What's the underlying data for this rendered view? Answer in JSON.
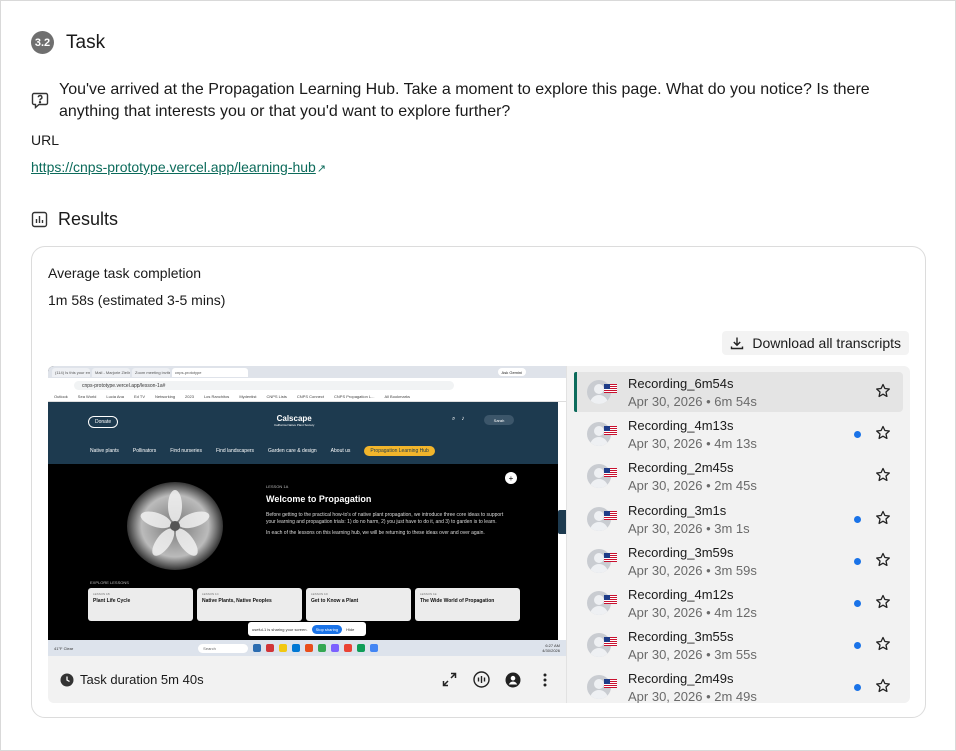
{
  "task": {
    "step": "3.2",
    "title": "Task"
  },
  "question": {
    "text": "You've arrived at the Propagation Learning Hub. Take a moment to explore this page. What do you notice? Is there anything that interests you or that you'd want to explore further?"
  },
  "url": {
    "label": "URL",
    "link": "https://cnps-prototype.vercel.app/learning-hub",
    "external_glyph": "↗"
  },
  "results": {
    "title": "Results",
    "avg_label": "Average task completion",
    "avg_value": "1m 58s (estimated 3-5 mins)",
    "download_label": "Download all transcripts"
  },
  "player": {
    "duration_label": "Task duration 5m 40s",
    "controls": [
      "expand-icon",
      "audio-waveform-icon",
      "person-icon",
      "more-vertical-icon"
    ],
    "screen": {
      "tabs": [
        "(114) Is this your email?",
        "Mail - Marjorie Zielinski - Outl",
        "Zoom meeting invite",
        "cnps-prototype"
      ],
      "gemini": "Ask Gemini",
      "address": "cnps-prototype.vercel.app/lesson-1a#",
      "bookmarks": [
        "Outlook",
        "Sea World",
        "Lucia Ana",
        "Ed TV",
        "Networking",
        "2023",
        "Los Ranchitos",
        "Mydentist",
        "CNPS Lists",
        "CNPS Connect",
        "CNPS Propagation L...",
        "All Bookmarks"
      ],
      "site": {
        "donate": "Donate",
        "logo": "Calscape",
        "logo_sub": "California Native Plant Society",
        "user": "Sarah",
        "nav": [
          "Native plants",
          "Pollinators",
          "Find nurseries",
          "Find landscapers",
          "Garden care & design",
          "About us"
        ],
        "hub_button": "Propagation Learning Hub",
        "lesson_kicker": "LESSON 1A",
        "lesson_title": "Welcome to Propagation",
        "lesson_body_1": "Before getting to the practical how-to's of native plant propagation, we introduce three core ideas to support your learning and propagation trials: 1) do no harm, 2) you just have to do it, and 3) to garden is to learn.",
        "lesson_body_2": "In each of the lessons on this learning hub, we will be returning to these ideas over and over again.",
        "explore_label": "EXPLORE LESSONS",
        "cards": [
          {
            "kicker": "LESSON 1B",
            "title": "Plant Life Cycle"
          },
          {
            "kicker": "LESSON 1C",
            "title": "Native Plants, Native Peoples"
          },
          {
            "kicker": "LESSON 1D",
            "title": "Get to Know a Plant"
          },
          {
            "kicker": "LESSON 1E",
            "title": "The Wide World of Propagation"
          }
        ],
        "share_text": "useful-1 is sharing your screen.",
        "stop_label": "Stop sharing",
        "hide_label": "Hide"
      },
      "taskbar": {
        "weather": "41°F Clear",
        "search": "Search",
        "time": "6:27 AM",
        "date": "4/30/2026"
      }
    }
  },
  "recordings": [
    {
      "name": "Recording_6m54s",
      "date": "Apr 30, 2026",
      "duration": "6m 54s",
      "new": false,
      "selected": true
    },
    {
      "name": "Recording_4m13s",
      "date": "Apr 30, 2026",
      "duration": "4m 13s",
      "new": true,
      "selected": false
    },
    {
      "name": "Recording_2m45s",
      "date": "Apr 30, 2026",
      "duration": "2m 45s",
      "new": false,
      "selected": false
    },
    {
      "name": "Recording_3m1s",
      "date": "Apr 30, 2026",
      "duration": "3m 1s",
      "new": true,
      "selected": false
    },
    {
      "name": "Recording_3m59s",
      "date": "Apr 30, 2026",
      "duration": "3m 59s",
      "new": true,
      "selected": false
    },
    {
      "name": "Recording_4m12s",
      "date": "Apr 30, 2026",
      "duration": "4m 12s",
      "new": true,
      "selected": false
    },
    {
      "name": "Recording_3m55s",
      "date": "Apr 30, 2026",
      "duration": "3m 55s",
      "new": true,
      "selected": false
    },
    {
      "name": "Recording_2m49s",
      "date": "Apr 30, 2026",
      "duration": "2m 49s",
      "new": true,
      "selected": false
    }
  ],
  "separator": " • ",
  "colors": {
    "accent": "#0c6b5b",
    "new_dot": "#1a73e8",
    "site_header": "#1d3a4f",
    "hub_button": "#f2b52b"
  }
}
